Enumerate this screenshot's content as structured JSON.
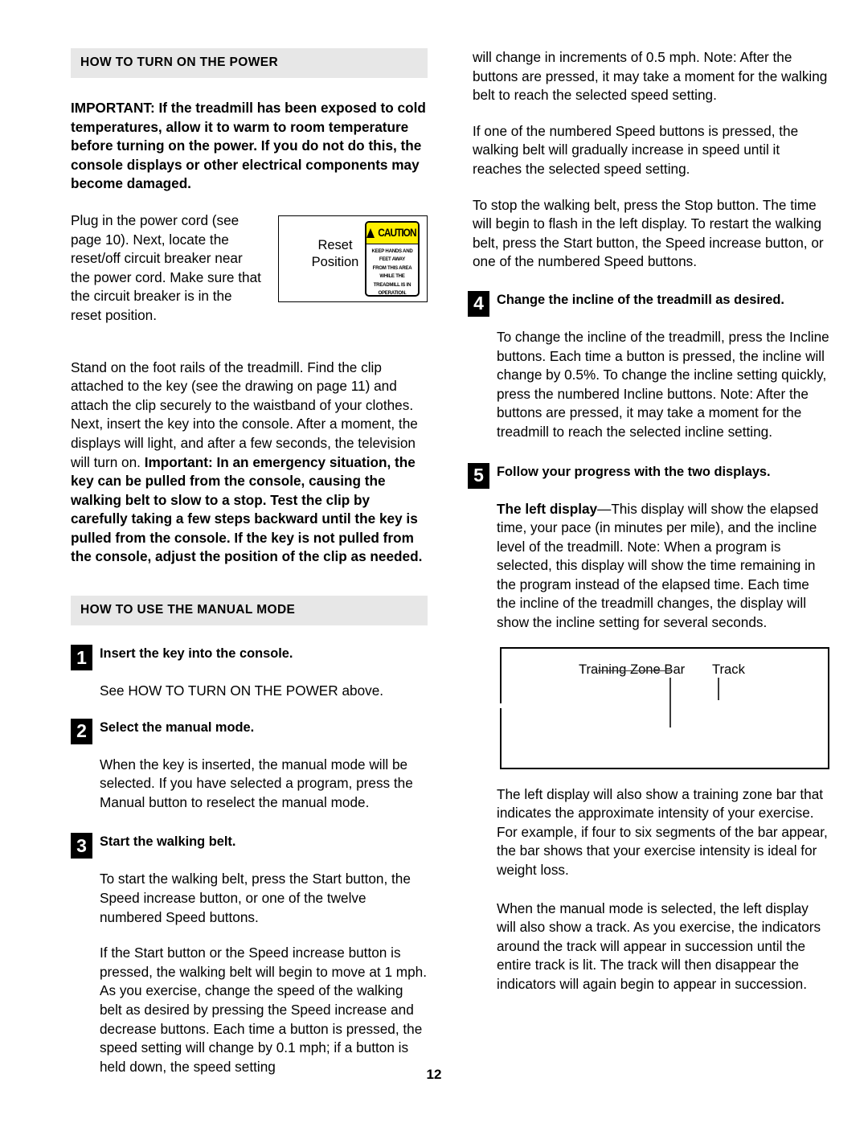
{
  "page": {
    "number": "12"
  },
  "left_column": {
    "section_header": "HOW TO TURN ON THE POWER",
    "important_notice": "IMPORTANT: If the treadmill has been exposed to cold temperatures, allow it to warm to room temperature before turning on the power. If you do not do this, the console displays or other electrical components may become damaged.",
    "power_cord_paragraph": "Plug in the power cord (see page 10). Next, locate the reset/off circuit breaker near the power cord. Make sure that the circuit breaker is in the reset position.",
    "figure_reset": {
      "label": "Reset\nPosition",
      "label_line1": "Reset",
      "label_line2": "Position",
      "caution": {
        "word": "CAUTION",
        "symbol": "warning-triangle",
        "line1": "KEEP HANDS AND FEET AWAY",
        "line2": "FROM THIS AREA WHILE THE",
        "line3": "TREADMILL IS IN OPERATION."
      }
    },
    "foot_rails_paragraph_plain": "Stand on the foot rails of the treadmill. Find the clip attached to the key (see the drawing on page 11) and attach the clip securely to the waistband of your clothes. Next, insert the key into the console. After a moment, the displays will light, and after a few seconds, the television will turn on. ",
    "foot_rails_paragraph_bold": "Important: In an emergency situation, the key can be pulled from the console, causing the walking belt to slow to a stop. Test the clip by carefully taking a few steps backward until the key is pulled from the console. If the key is not pulled from the console, adjust the position of the clip as needed.",
    "manual_mode_header": "HOW TO USE THE MANUAL MODE",
    "steps": [
      {
        "number": "1",
        "title": "Insert the key into the console.",
        "body": [
          "See HOW TO TURN ON THE POWER above."
        ]
      },
      {
        "number": "2",
        "title": "Select the manual mode.",
        "body": [
          "When the key is inserted, the manual mode will be selected. If you have selected a program, press the Manual button to reselect the manual mode."
        ]
      },
      {
        "number": "3",
        "title": "Start the walking belt.",
        "body": [
          "To start the walking belt, press the Start button, the Speed increase button, or one of the twelve numbered Speed buttons.",
          "If the Start button or the Speed increase button is pressed, the walking belt will begin to move at 1 mph. As you exercise, change the speed of the walking belt as desired by pressing the Speed increase and decrease buttons. Each time a button is pressed, the speed setting will change by 0.1 mph; if a button is held down, the speed setting"
        ]
      }
    ]
  },
  "right_column": {
    "continuation_paragraphs": [
      "will change in increments of 0.5 mph. Note: After the buttons are pressed, it may take a moment for the walking belt to reach the selected speed setting.",
      "If one of the numbered Speed buttons is pressed, the walking belt will gradually increase in speed until it reaches the selected speed setting.",
      "To stop the walking belt, press the Stop button. The time will begin to flash in the left display. To restart the walking belt, press the Start button, the Speed increase button, or one of the numbered Speed buttons."
    ],
    "steps": [
      {
        "number": "4",
        "title": "Change the incline of the treadmill as desired.",
        "body": [
          "To change the incline of the treadmill, press the Incline buttons. Each time a button is pressed, the incline will change by 0.5%. To change the incline setting quickly, press the numbered Incline buttons. Note: After the buttons are pressed, it may take a moment for the treadmill to reach the selected incline setting."
        ]
      },
      {
        "number": "5",
        "title": "Follow your progress with the two displays.",
        "body_bold_lead": "The left display",
        "body_lead_rest": "—This display will show the elapsed time, your pace (in minutes per mile), and the incline level of the treadmill. Note: When a program is selected, this display will show the time remaining in the program instead of the elapsed time. Each time the incline of the treadmill changes, the display will show the incline setting for several seconds."
      }
    ],
    "figure_display": {
      "label_training_zone_bar": "Training Zone Bar",
      "label_track": "Track"
    },
    "after_figure_paragraphs": [
      "The left display will also show a training zone bar that indicates the approximate intensity of your exercise. For example, if four to six segments of the bar appear, the bar shows that your exercise intensity is ideal for weight loss.",
      "When the manual mode is selected, the left display will also show a track. As you exercise, the indicators around the track will appear in succession until the entire track is lit. The track will then disappear the indicators will again begin to appear in succession."
    ]
  },
  "colors": {
    "section_bar_bg": "#e7e7e7",
    "caution_yellow": "#ffef00",
    "text": "#000000",
    "page_bg": "#ffffff"
  }
}
